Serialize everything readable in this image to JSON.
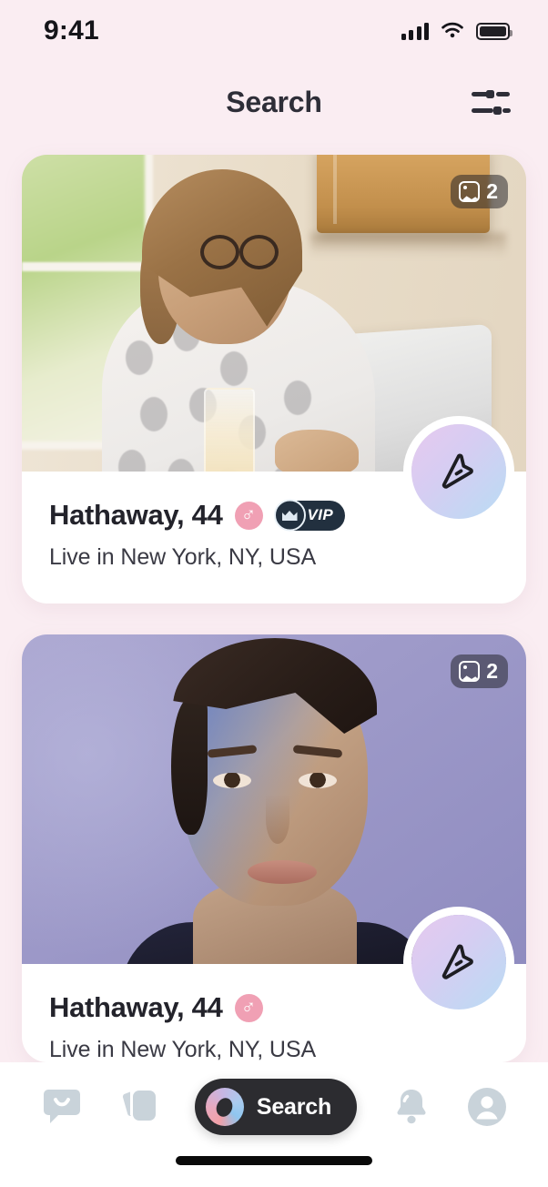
{
  "status_bar": {
    "time": "9:41",
    "signal_icon": "cellular-signal-icon",
    "wifi_icon": "wifi-icon",
    "battery_icon": "battery-full-icon"
  },
  "header": {
    "title": "Search",
    "filter_icon": "filter-sliders-icon"
  },
  "theme": {
    "background": "#faedf2",
    "card_background": "#ffffff",
    "title_color": "#2e2e38",
    "gender_badge_color": "#f0a0b4",
    "vip_badge_color": "#22303f",
    "nav_pill_color": "#2c2c30",
    "nav_icon_color": "#c9d3da"
  },
  "cards": [
    {
      "name_age": "Hathaway, 44",
      "location": "Live in New York, NY, USA",
      "photo_count": "2",
      "photo_count_icon": "image-stack-icon",
      "gender_symbol": "♂",
      "gender_badge_name": "male-gender-badge",
      "has_vip": true,
      "vip_label": "VIP",
      "vip_crown_icon": "crown-icon",
      "send_icon": "paper-plane-icon",
      "photo_alt": "woman-with-glasses-at-laptop"
    },
    {
      "name_age": "Hathaway, 44",
      "location": "Live in New York, NY, USA",
      "photo_count": "2",
      "photo_count_icon": "image-stack-icon",
      "gender_symbol": "♂",
      "gender_badge_name": "male-gender-badge",
      "has_vip": false,
      "vip_label": "",
      "vip_crown_icon": "crown-icon",
      "send_icon": "paper-plane-icon",
      "photo_alt": "blue-lit-portrait"
    }
  ],
  "bottom_nav": {
    "items": [
      {
        "name": "chat-icon",
        "label": ""
      },
      {
        "name": "cards-stack-icon",
        "label": ""
      },
      {
        "name": "search-tab",
        "label": "Search"
      },
      {
        "name": "notifications-bell-icon",
        "label": ""
      },
      {
        "name": "profile-avatar-icon",
        "label": ""
      }
    ],
    "active": "Search",
    "home_indicator": "home-indicator"
  }
}
